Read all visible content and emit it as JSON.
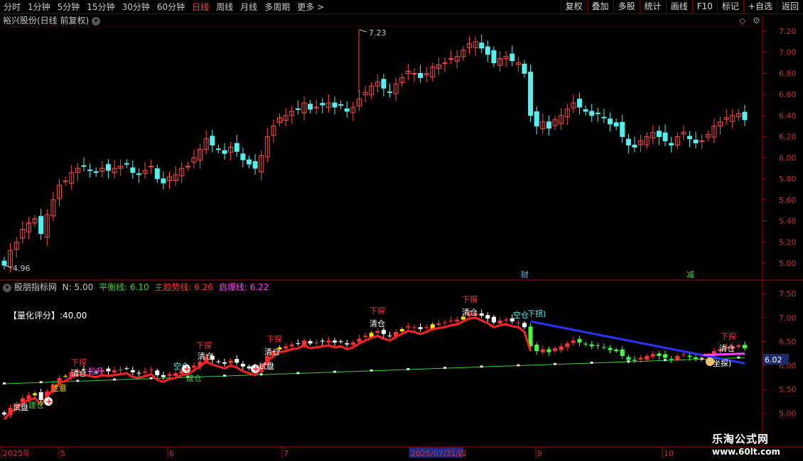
{
  "toolbar": {
    "periods": [
      "分时",
      "1分钟",
      "5分钟",
      "15分钟",
      "30分钟",
      "60分钟",
      "日线",
      "周线",
      "月线",
      "多周期",
      "更多 >"
    ],
    "active_period": "日线",
    "tools": [
      "复权",
      "叠加",
      "多股",
      "统计",
      "画线",
      "F10",
      "标记",
      "+自选",
      "返回"
    ]
  },
  "main": {
    "title": "裕兴股份(日线 前复权)",
    "peak_label": "7.23",
    "trough_label": "4.96",
    "event_marks": [
      "财",
      "减"
    ]
  },
  "indicator": {
    "name": "股朋指标网",
    "n_label": "N: 5.00",
    "balance_label": "平衡线: 6.10",
    "trend_label": "主趋势线: 6.26",
    "burst_label": "启爆线: 6.22",
    "score_label": "【量化评分】:40.00",
    "current_value": "6.02",
    "signals": {
      "probe": "下探",
      "clear": "清仓",
      "pull_up": "拉升",
      "build": "建仓",
      "attention": "注意",
      "trial": "试盘",
      "empty": "空仓",
      "down_turn": "下拐)",
      "sit_probe": "坐探)"
    }
  },
  "axis": {
    "date_labels": [
      "2025年",
      "5",
      "6",
      "7",
      "2025/07/31/四",
      "9",
      "10"
    ]
  },
  "watermark": {
    "line1": "乐淘公式网",
    "line2": "www.60lt.com"
  },
  "colors": {
    "up": "#ff4a4a",
    "down": "#54f0f0",
    "trend": "#ff2020",
    "balance": "#3ad03a",
    "burst": "#2a34ff",
    "axis": "#b00000"
  },
  "chart_data": {
    "type": "candlestick",
    "title": "裕兴股份(日线 前复权)",
    "y_ticks_main": [
      5.0,
      5.2,
      5.4,
      5.6,
      5.8,
      6.0,
      6.2,
      6.4,
      6.6,
      6.8,
      7.0,
      7.2
    ],
    "y_ticks_indicator": [
      5.0,
      5.5,
      6.0,
      6.5,
      7.0,
      7.5
    ],
    "ylim_main": [
      4.82,
      7.34
    ],
    "ylim_indicator": [
      4.84,
      7.78
    ],
    "close": [
      4.98,
      5.12,
      5.2,
      5.32,
      5.38,
      5.42,
      5.28,
      5.46,
      5.6,
      5.74,
      5.78,
      5.86,
      5.9,
      5.92,
      5.88,
      5.86,
      5.9,
      5.88,
      5.9,
      5.92,
      5.94,
      5.86,
      5.84,
      5.88,
      5.92,
      5.8,
      5.76,
      5.82,
      5.84,
      5.9,
      5.92,
      6.0,
      6.08,
      6.18,
      6.12,
      6.08,
      6.04,
      6.1,
      6.06,
      5.98,
      5.94,
      5.9,
      6.02,
      6.2,
      6.3,
      6.38,
      6.4,
      6.44,
      6.46,
      6.52,
      6.46,
      6.48,
      6.5,
      6.52,
      6.48,
      6.5,
      6.44,
      6.48,
      6.56,
      6.62,
      6.68,
      6.72,
      6.66,
      6.62,
      6.7,
      6.76,
      6.82,
      6.8,
      6.76,
      6.8,
      6.86,
      6.88,
      6.9,
      6.94,
      6.96,
      7.02,
      7.08,
      7.1,
      7.04,
      6.98,
      6.9,
      6.94,
      6.96,
      6.92,
      6.9,
      6.8,
      6.4,
      6.3,
      6.34,
      6.28,
      6.36,
      6.4,
      6.46,
      6.52,
      6.48,
      6.44,
      6.4,
      6.42,
      6.38,
      6.32,
      6.3,
      6.2,
      6.12,
      6.1,
      6.16,
      6.2,
      6.24,
      6.2,
      6.16,
      6.12,
      6.2,
      6.24,
      6.18,
      6.14,
      6.16,
      6.22,
      6.3,
      6.34,
      6.38,
      6.4,
      6.42,
      6.36
    ],
    "indicator_lines": [
      {
        "name": "主趋势线",
        "color": "#ff2020"
      },
      {
        "name": "平衡线",
        "color": "#3ad03a"
      },
      {
        "name": "启爆线",
        "color": "#2a34ff"
      }
    ]
  }
}
